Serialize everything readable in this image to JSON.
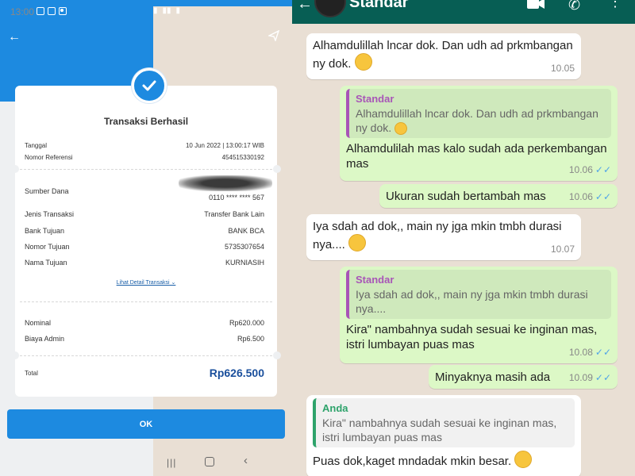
{
  "left": {
    "status": {
      "time": "13:00"
    },
    "receipt": {
      "title": "Transaksi Berhasil",
      "tanggal_label": "Tanggal",
      "tanggal_value": "10 Jun 2022 | 13:00:17 WIB",
      "ref_label": "Nomor Referensi",
      "ref_value": "454515330192",
      "sumber_label": "Sumber Dana",
      "sumber_value": "0110 **** **** 567",
      "jenis_label": "Jenis Transaksi",
      "jenis_value": "Transfer Bank Lain",
      "bank_label": "Bank Tujuan",
      "bank_value": "BANK BCA",
      "nomor_label": "Nomor Tujuan",
      "nomor_value": "5735307654",
      "nama_label": "Nama Tujuan",
      "nama_value": "KURNIASIH",
      "detail_link": "Lihat Detail Transaksi",
      "nominal_label": "Nominal",
      "nominal_value": "Rp620.000",
      "admin_label": "Biaya Admin",
      "admin_value": "Rp6.500",
      "total_label": "Total",
      "total_value": "Rp626.500"
    },
    "ok_label": "OK"
  },
  "chat": {
    "contact_name": "Standar",
    "messages": [
      {
        "text": "Alhamdulillah lncar dok. Dan udh ad prkmbangan ny dok.",
        "time": "10.05"
      },
      {
        "quote_name": "Standar",
        "quote_text": "Alhamdulillah lncar dok. Dan udh ad prkmbangan ny dok.",
        "text": "Alhamdulilah mas kalo sudah ada perkembangan mas",
        "time": "10.06"
      },
      {
        "text": "Ukuran sudah bertambah mas",
        "time": "10.06"
      },
      {
        "text": "Iya sdah ad dok,, main ny jga mkin tmbh durasi nya....",
        "time": "10.07"
      },
      {
        "quote_name": "Standar",
        "quote_text": "Iya sdah ad dok,, main ny jga mkin tmbh durasi nya....",
        "text": "Kira\" nambahnya sudah sesuai ke inginan mas, istri lumbayan puas mas",
        "time": "10.08"
      },
      {
        "text": "Minyaknya masih ada",
        "time": "10.09"
      },
      {
        "quote_name": "Anda",
        "quote_text": "Kira\" nambahnya sudah sesuai ke inginan mas, istri lumbayan puas mas",
        "text": "Puas dok,kaget mndadak mkin besar.",
        "time": ""
      }
    ]
  }
}
